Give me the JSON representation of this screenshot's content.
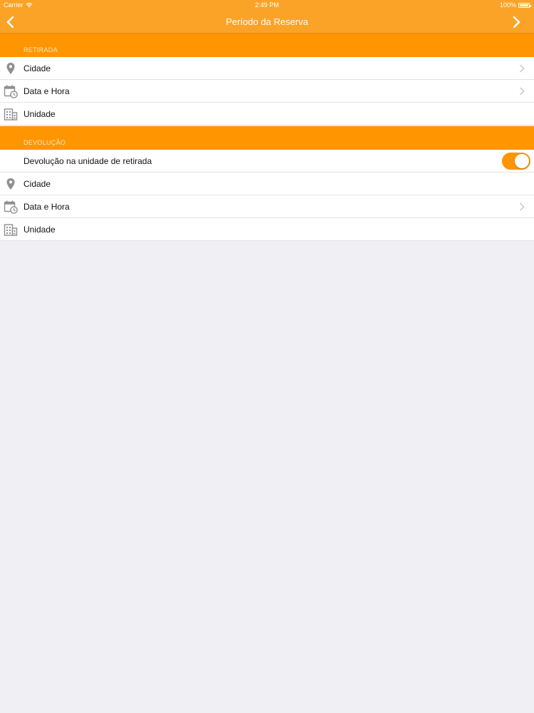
{
  "status_bar": {
    "carrier": "Carrier",
    "time": "2:49 PM",
    "battery": "100%"
  },
  "nav": {
    "title": "Período da Reserva",
    "back_icon": "chevron-left-icon",
    "forward_icon": "chevron-right-icon"
  },
  "retirada": {
    "header": "RETIRADA",
    "cidade": "Cidade",
    "data_hora": "Data e Hora",
    "unidade": "Unidade"
  },
  "devolucao": {
    "header": "DEVOLUÇÃO",
    "toggle_label": "Devolução na unidade de retirada",
    "toggle_on": true,
    "cidade": "Cidade",
    "data_hora": "Data e Hora",
    "unidade": "Unidade"
  },
  "colors": {
    "brand": "#fba326",
    "section_header": "#ff9500",
    "background": "#efeff4",
    "icon_gray": "#8e8e93"
  }
}
